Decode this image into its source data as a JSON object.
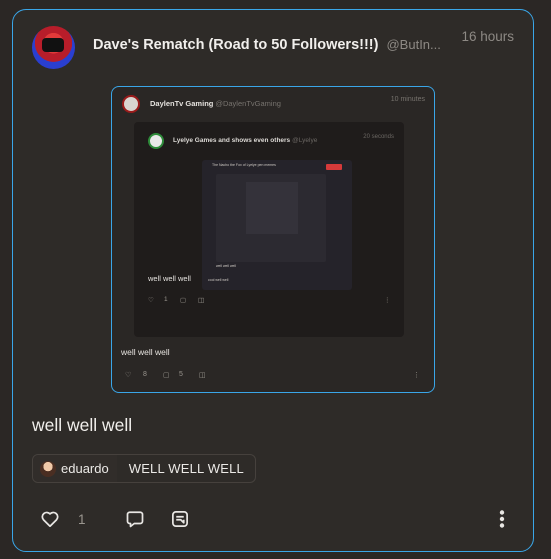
{
  "post": {
    "author_name": "Dave's Rematch (Road to 50 Followers!!!)",
    "author_handle": "@ButIn...",
    "time": "16 hours",
    "text": "well well well",
    "like_count": "1"
  },
  "embed": {
    "author_name": "DaylenTv Gaming",
    "author_handle": "@DaylenTvGaming",
    "time": "10 minutes",
    "text": "well well well",
    "like_count": "8",
    "reply_count": "5",
    "inner": {
      "author_name": "Lyelye Games and shows even others",
      "author_handle": "@Lyelye",
      "time": "20 seconds",
      "text": "well well well",
      "like_count": "1",
      "deep": {
        "title": "The Nacho the Fox of Lyelye pen memes",
        "sub": "well well well",
        "reply": "cool well well"
      }
    }
  },
  "reply_chip": {
    "user": "eduardo",
    "text": "WELL WELL WELL"
  },
  "colors": {
    "accent": "#3aa6e8",
    "background": "#2b2725",
    "card": "#2e2b28"
  },
  "icons": [
    "heart-icon",
    "comment-icon",
    "quote-icon",
    "more-icon"
  ]
}
